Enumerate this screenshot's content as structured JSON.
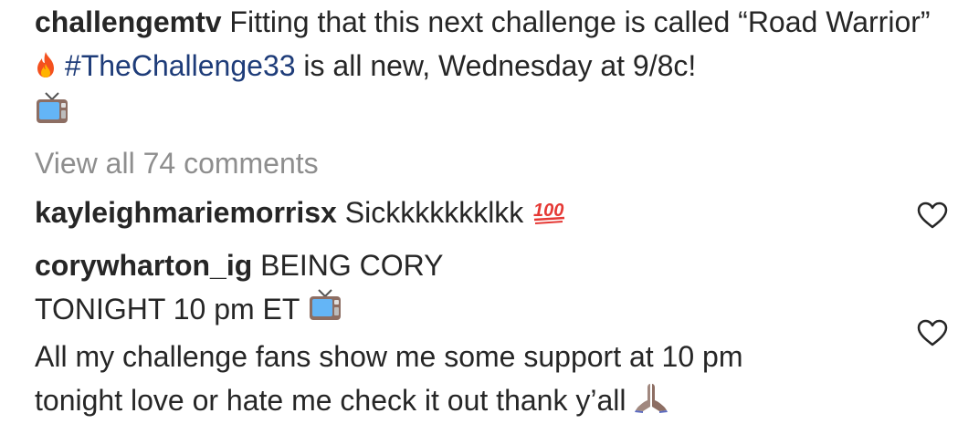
{
  "post": {
    "username": "challengemtv",
    "caption_part1": " Fitting that this next challenge is called “Road Warrior” ",
    "fire_emoji": "fire-icon",
    "hashtag": "#TheChallenge33",
    "caption_part2": " is all new, Wednesday at 9/8c!",
    "tv_emoji": "television-icon"
  },
  "comments_link": "View all 74 comments",
  "comments": [
    {
      "username": "kayleighmariemorrisx",
      "text": " Sickkkkkkklkk ",
      "emoji": "hundred-points-icon",
      "liked": false
    },
    {
      "username": "corywharton_ig",
      "line1": " BEING CORY",
      "line2": "TONIGHT 10 pm ET ",
      "line2_emoji": "television-icon",
      "line3": "All my challenge fans show me some support at 10 pm",
      "line4": "tonight love or hate me check it out thank y’all ",
      "line4_emoji": "folded-hands-icon",
      "liked": false
    }
  ],
  "colors": {
    "text": "#262626",
    "muted": "#8e8e8e",
    "hashtag": "#1e3c79",
    "heart_outline": "#262626"
  }
}
